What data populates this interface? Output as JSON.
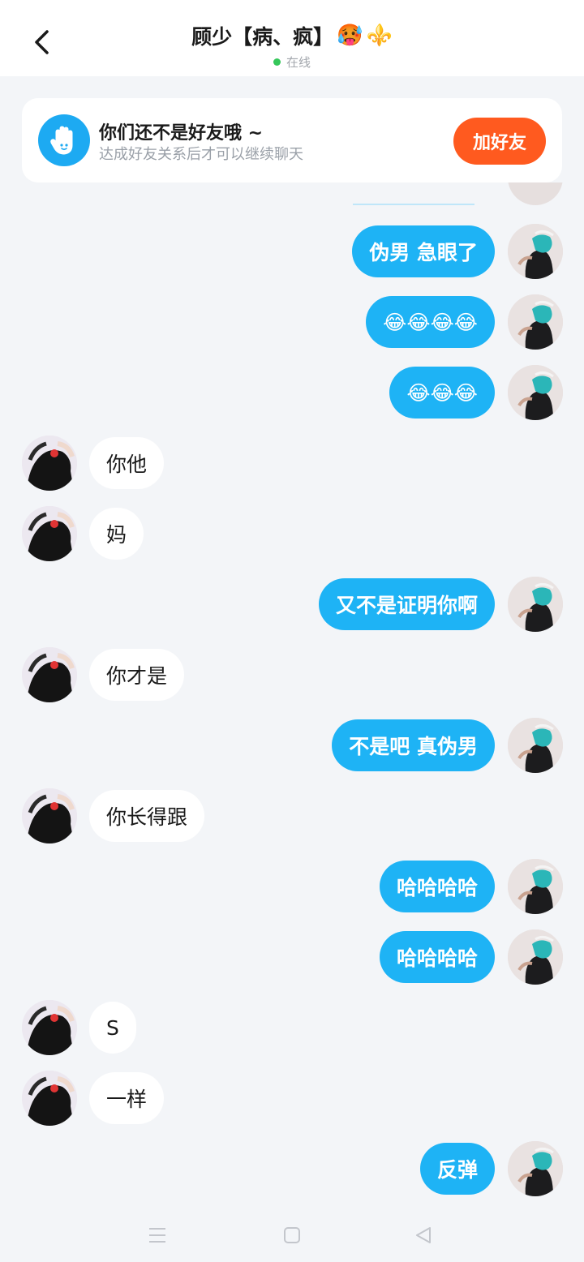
{
  "header": {
    "title": "顾少【病、疯】",
    "title_emojis": [
      "🥵",
      "⚜️"
    ],
    "status": "在线",
    "status_color": "#35c75a"
  },
  "friend_card": {
    "title": "你们还不是好友哦 ~",
    "subtitle": "达成好友关系后才可以继续聊天",
    "button": "加好友",
    "button_color": "#ff5a1f",
    "icon": "hand-wave-icon"
  },
  "messages": [
    {
      "from": "me",
      "text": "伪男 急眼了"
    },
    {
      "from": "me",
      "text": "😂😂😂😂"
    },
    {
      "from": "me",
      "text": "😂😂😂"
    },
    {
      "from": "them",
      "text": "你他"
    },
    {
      "from": "them",
      "text": "妈"
    },
    {
      "from": "me",
      "text": "又不是证明你啊"
    },
    {
      "from": "them",
      "text": "你才是"
    },
    {
      "from": "me",
      "text": "不是吧  真伪男"
    },
    {
      "from": "them",
      "text": "你长得跟"
    },
    {
      "from": "me",
      "text": "哈哈哈哈"
    },
    {
      "from": "me",
      "text": "哈哈哈哈"
    },
    {
      "from": "them",
      "text": "S"
    },
    {
      "from": "them",
      "text": "一样"
    },
    {
      "from": "me",
      "text": "反弹"
    }
  ],
  "colors": {
    "my_bubble": "#1eb3f5",
    "their_bubble": "#ffffff",
    "background": "#f3f5f8"
  },
  "system_nav": [
    "menu-icon",
    "home-square-icon",
    "back-triangle-icon"
  ]
}
